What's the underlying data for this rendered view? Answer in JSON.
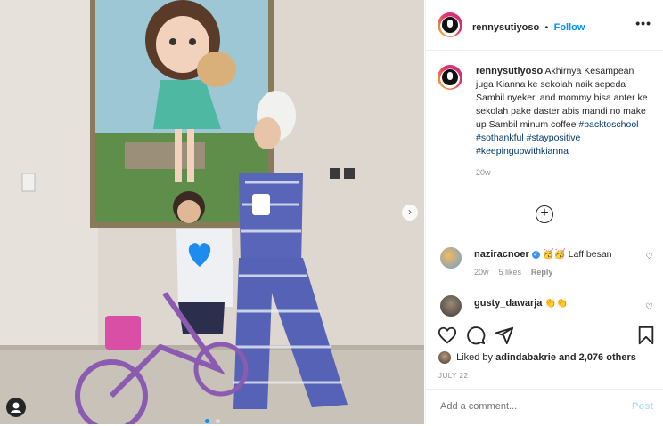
{
  "post": {
    "username": "rennysutiyoso",
    "follow_label": "Follow",
    "separator": "•",
    "more_label": "•••",
    "caption_text": "Akhirnya Kesampean juga Kianna ke sekolah naik sepeda Sambil nyeker, and mommy bisa anter ke sekolah pake daster abis mandi no make up Sambil minum coffee",
    "hashtags": [
      "#backtoschool",
      "#sothankful",
      "#staypositive",
      "#keepingupwithkianna"
    ],
    "caption_age": "20w",
    "load_more_icon": "plus-circle-icon"
  },
  "comments": [
    {
      "username": "naziracnoer",
      "text": "🥳🥳 Laff besan",
      "age": "20w",
      "likes": "5 likes",
      "reply": "Reply",
      "verified": true
    },
    {
      "username": "gusty_dawarja",
      "text": "👏👏"
    }
  ],
  "engagement": {
    "likes_prefix": "Liked by",
    "liked_by_user": "adindabakrie",
    "likes_suffix": "and 2,076 others",
    "date": "JULY 22"
  },
  "add_comment": {
    "placeholder": "Add a comment...",
    "post_label": "Post"
  },
  "colors": {
    "accent": "#0095f6",
    "hashtag": "#00376b",
    "muted": "#8e8e8e"
  }
}
